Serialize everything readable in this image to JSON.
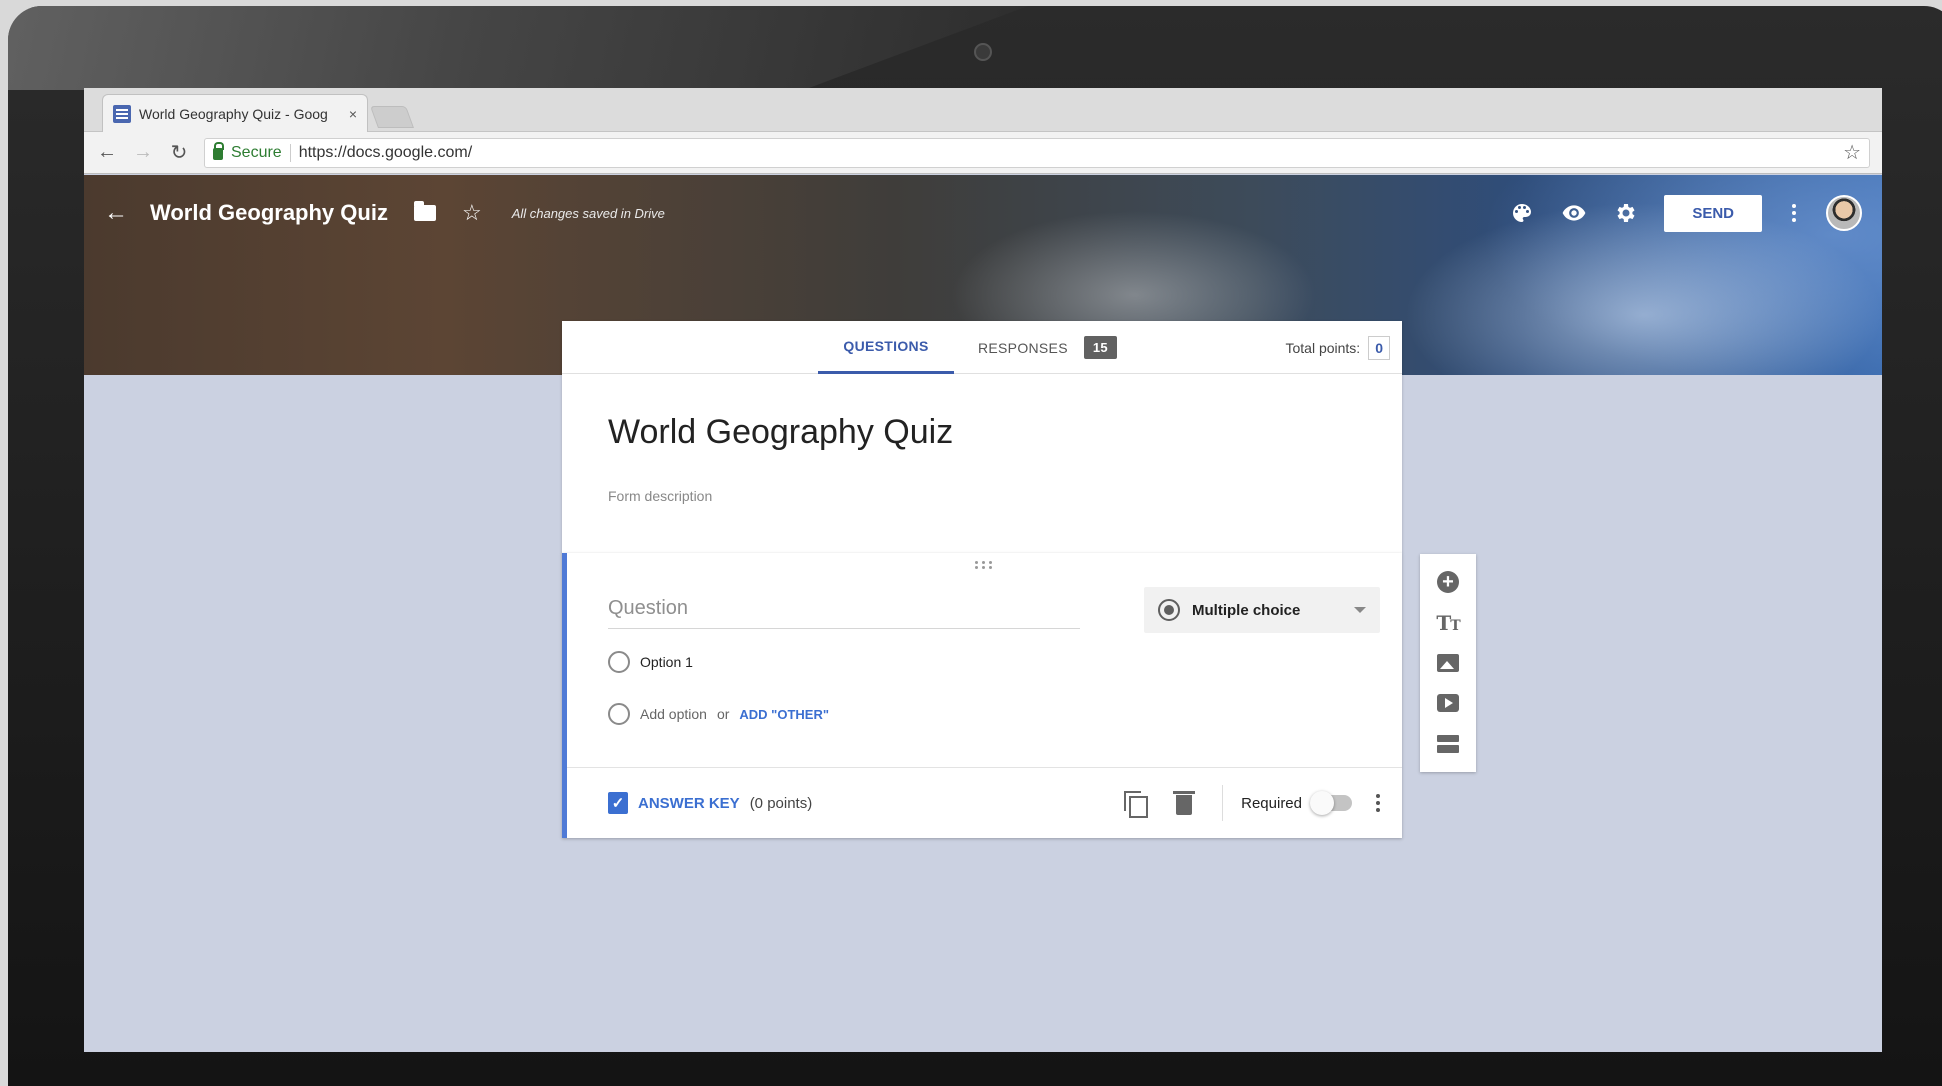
{
  "browser": {
    "tab_title": "World Geography Quiz - Goog",
    "tab_close": "×",
    "url_secure": "Secure",
    "url": "https://docs.google.com/"
  },
  "header": {
    "title": "World Geography Quiz",
    "saved_status": "All changes saved in Drive",
    "send_label": "SEND"
  },
  "tabs": {
    "questions_label": "QUESTIONS",
    "responses_label": "RESPONSES",
    "responses_count": "15",
    "total_points_label": "Total points:",
    "total_points_value": "0"
  },
  "form": {
    "title": "World Geography Quiz",
    "description_placeholder": "Form description"
  },
  "question": {
    "placeholder": "Question",
    "type": "Multiple choice",
    "options": [
      "Option 1"
    ],
    "add_option": "Add option",
    "or": "or",
    "add_other": "ADD \"OTHER\"",
    "answer_key_label": "ANSWER KEY",
    "answer_key_points": "(0 points)",
    "required_label": "Required"
  },
  "colors": {
    "accent": "#3b5bab",
    "active_border": "#4f7ad6",
    "background": "#cbd1e1"
  }
}
